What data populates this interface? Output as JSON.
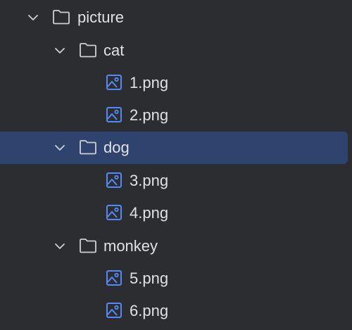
{
  "colors": {
    "background": "#2b2d30",
    "selection": "#2e436e",
    "text": "#dfe1e5",
    "icon_outline": "#ced0d6",
    "image_icon": "#548af7"
  },
  "tree": {
    "root": {
      "label": "picture",
      "icon": "folder-icon",
      "expanded": true
    },
    "folders": [
      {
        "label": "cat",
        "icon": "folder-icon",
        "expanded": true,
        "selected": false,
        "files": [
          {
            "label": "1.png",
            "icon": "image-file-icon"
          },
          {
            "label": "2.png",
            "icon": "image-file-icon"
          }
        ]
      },
      {
        "label": "dog",
        "icon": "folder-icon",
        "expanded": true,
        "selected": true,
        "files": [
          {
            "label": "3.png",
            "icon": "image-file-icon"
          },
          {
            "label": "4.png",
            "icon": "image-file-icon"
          }
        ]
      },
      {
        "label": "monkey",
        "icon": "folder-icon",
        "expanded": true,
        "selected": false,
        "files": [
          {
            "label": "5.png",
            "icon": "image-file-icon"
          },
          {
            "label": "6.png",
            "icon": "image-file-icon"
          }
        ]
      }
    ]
  }
}
